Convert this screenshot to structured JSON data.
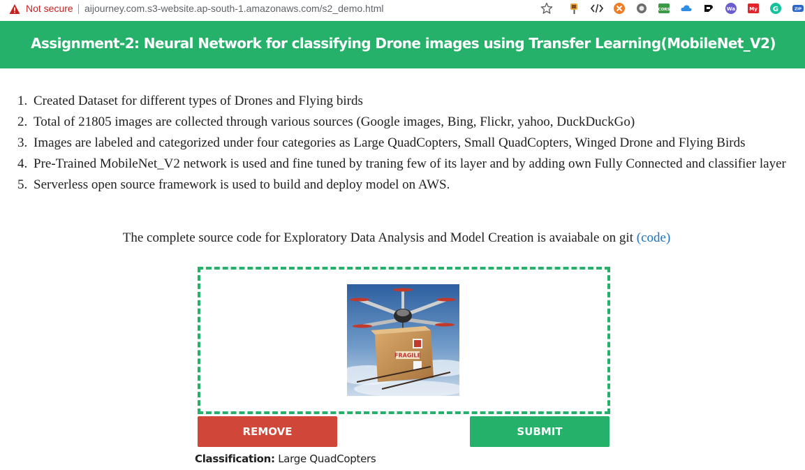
{
  "browser": {
    "security_label": "Not secure",
    "url": "aijourney.com.s3-website.ap-south-1.amazonaws.com/s2_demo.html",
    "extensions": [
      {
        "icon": "paint-brush-icon"
      },
      {
        "icon": "code-tag-icon"
      },
      {
        "icon": "orange-cross-icon"
      },
      {
        "icon": "grey-circle-icon"
      },
      {
        "icon": "cors-icon",
        "text": "CORS"
      },
      {
        "icon": "cloud-icon"
      },
      {
        "icon": "dark-logo-icon"
      },
      {
        "icon": "wappalyzer-icon",
        "text": "Wa"
      },
      {
        "icon": "wego-icon",
        "text": "My"
      },
      {
        "icon": "grammarly-icon",
        "text": "G"
      },
      {
        "icon": "zip-icon",
        "text": "ZIP"
      }
    ]
  },
  "header": {
    "title": "Assignment-2: Neural Network for classifying Drone images using Transfer Learning(MobileNet_V2)",
    "color": "#25b16a"
  },
  "list": [
    {
      "num": "1.",
      "text": "Created Dataset for different types of Drones and Flying birds"
    },
    {
      "num": "2.",
      "text": "Total of 21805 images are collected through various sources (Google images, Bing, Flickr, yahoo, DuckDuckGo)"
    },
    {
      "num": "3.",
      "text": "Images are labeled and categorized under four categories as Large QuadCopters, Small QuadCopters, Winged Drone and Flying Birds"
    },
    {
      "num": "4.",
      "text": "Pre-Trained MobileNet_V2 network is used and fine tuned by traning few of its layer and by adding own Fully Connected and classifier layer"
    },
    {
      "num": "5.",
      "text": "Serverless open source framework is used to build and deploy model on AWS."
    }
  ],
  "code_line": {
    "text": "The complete source code for Exploratory Data Analysis and Model Creation is avaiabale on git",
    "open_paren": "(",
    "link": "code",
    "close_paren": ")"
  },
  "upload": {
    "image_alt": "drone carrying a fragile cardboard package",
    "package_label": "FRAGILE",
    "remove_label": "REMOVE",
    "submit_label": "SUBMIT",
    "remove_color": "#d0473a",
    "submit_color": "#25b16a"
  },
  "result": {
    "label": "Classification:",
    "value": "Large QuadCopters"
  }
}
